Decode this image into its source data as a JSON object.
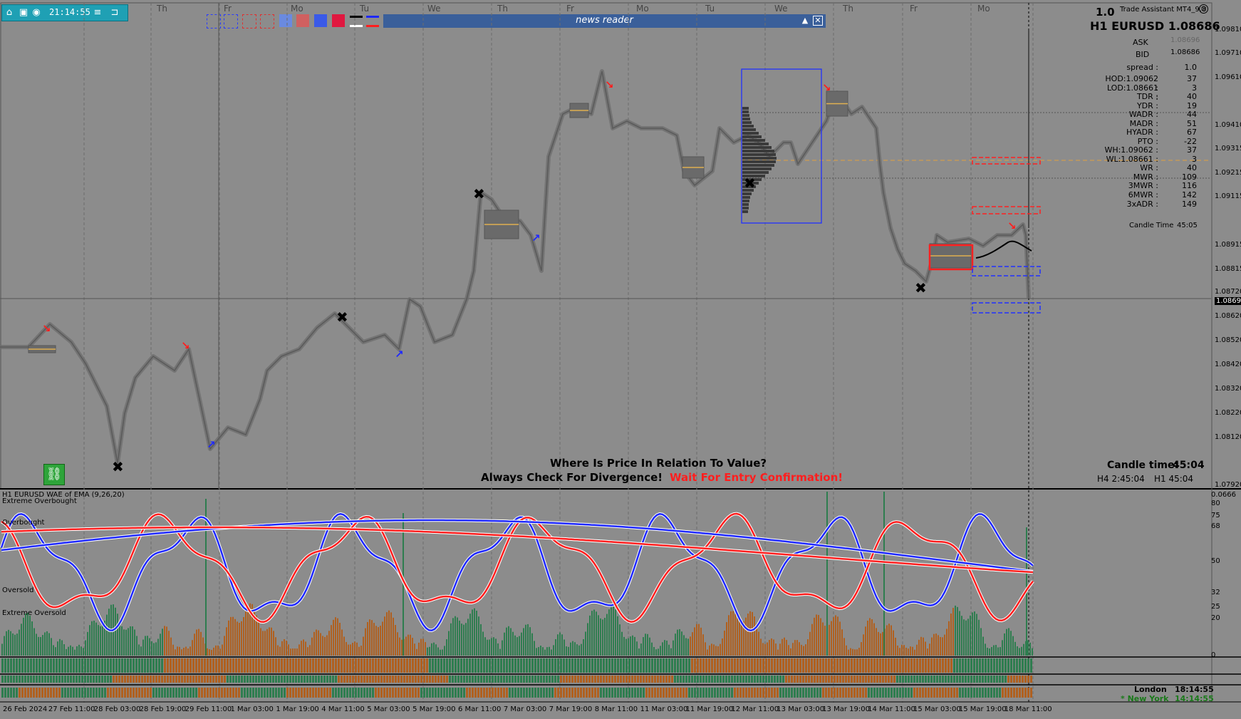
{
  "toolbar": {
    "clock": "21:14:55",
    "camera_icon": "camera-icon",
    "eye_icon": "eye-icon",
    "menu_icon": "menu-icon",
    "expand_icon": "expand-icon"
  },
  "news_reader": {
    "title": "news reader",
    "collapse_icon": "triangle-up-icon",
    "close_icon": "close-icon"
  },
  "day_labels": [
    "Th",
    "Fr",
    "Mo",
    "Tu",
    "We",
    "Th",
    "Fr",
    "Mo",
    "Tu",
    "We",
    "Th",
    "Fr",
    "Mo"
  ],
  "header": {
    "version": "1.0",
    "product": "Trade Assistant MT4_9.8",
    "symbol_line": "H1 EURUSD 1.08686",
    "ask_label": "ASK",
    "ask_value": "1.08696",
    "bid_label": "BID",
    "bid_value": "1.08686"
  },
  "stats": [
    {
      "k": "spread :",
      "v": "1.0"
    },
    {
      "k": "HOD:1.09062 :",
      "v": "37"
    },
    {
      "k": "LOD:1.08661 :",
      "v": "3"
    },
    {
      "k": "TDR :",
      "v": "40"
    },
    {
      "k": "YDR :",
      "v": "19"
    },
    {
      "k": "WADR :",
      "v": "44"
    },
    {
      "k": "MADR :",
      "v": "51"
    },
    {
      "k": "HYADR :",
      "v": "67"
    },
    {
      "k": "PTO :",
      "v": "-22"
    },
    {
      "k": "WH:1.09062 :",
      "v": "37"
    },
    {
      "k": "WL:1.08661 :",
      "v": "3"
    },
    {
      "k": "WR :",
      "v": "40"
    },
    {
      "k": "MWR :",
      "v": "109"
    },
    {
      "k": "3MWR :",
      "v": "116"
    },
    {
      "k": "6MWR :",
      "v": "142"
    },
    {
      "k": "3xADR :",
      "v": "149"
    }
  ],
  "candle_time_small": {
    "label": "Candle Time",
    "value": "45:05"
  },
  "candle_time_big": {
    "label": "Candle time:",
    "value": "45:04"
  },
  "h4_line": "H4 2:45:04",
  "h1_line": "H1 45:04",
  "price_axis": [
    "1.09810",
    "1.09710",
    "1.09610",
    "1.09410",
    "1.09315",
    "1.09215",
    "1.09115",
    "1.08915",
    "1.08815",
    "1.08720",
    "1.08691",
    "1.08620",
    "1.08520",
    "1.08420",
    "1.08320",
    "1.08220",
    "1.08120",
    "1.07920"
  ],
  "messages": {
    "line1": "Where Is Price In Relation To Value?",
    "line2": "Always Check For Divergence!",
    "line3": "Wait For Entry Confirmation!"
  },
  "indicator": {
    "title": "H1 EURUSD WAE of EMA (9,26,20)",
    "levels": [
      "Extreme Overbought",
      "Overbought",
      "Oversold",
      "Extreme Oversold"
    ],
    "axis": [
      "0.0666",
      "80",
      "75",
      "68",
      "50",
      "32",
      "25",
      "20",
      "0"
    ]
  },
  "sessions": [
    {
      "name": "London",
      "time": "18:14:55"
    },
    {
      "name": "* New York",
      "time": "14:14:55"
    }
  ],
  "x_axis": [
    "26 Feb 2024",
    "27 Feb 11:00",
    "28 Feb 03:00",
    "28 Feb 19:00",
    "29 Feb 11:00",
    "1 Mar 03:00",
    "1 Mar 19:00",
    "4 Mar 11:00",
    "5 Mar 03:00",
    "5 Mar 19:00",
    "6 Mar 11:00",
    "7 Mar 03:00",
    "7 Mar 19:00",
    "8 Mar 11:00",
    "11 Mar 03:00",
    "11 Mar 19:00",
    "12 Mar 11:00",
    "13 Mar 03:00",
    "13 Mar 19:00",
    "14 Mar 11:00",
    "15 Mar 03:00",
    "15 Mar 19:00",
    "18 Mar 11:00"
  ],
  "colors": {
    "bg": "#8c8c8c",
    "bull": "#2e8b57",
    "bear": "#b5601e",
    "red": "#ff1e1e",
    "blue": "#1e28ff",
    "teal": "#1fa0b4"
  }
}
